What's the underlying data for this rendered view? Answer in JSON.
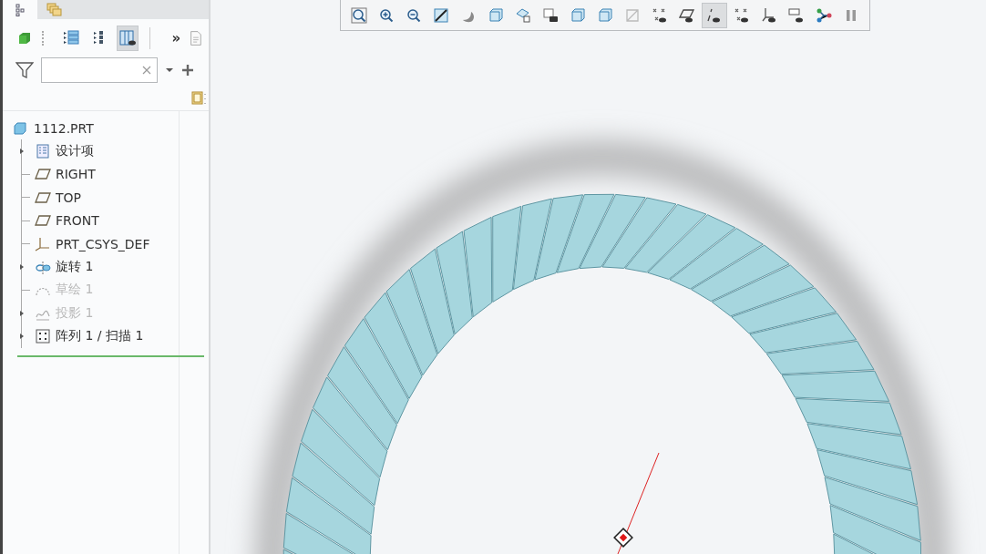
{
  "panel_tabs": [
    {
      "kind": "model-tree",
      "selected": true
    },
    {
      "kind": "layers",
      "selected": false
    }
  ],
  "panel_toolbar": [
    {
      "kind": "cube",
      "selected": false
    },
    {
      "kind": "tree-list",
      "selected": false
    },
    {
      "kind": "tree-dots",
      "selected": false
    },
    {
      "kind": "columns-eye",
      "selected": true
    }
  ],
  "more_label": "»",
  "tree": {
    "label": "1112.PRT",
    "kind": "part",
    "children": [
      {
        "label": "设计项",
        "kind": "design-items",
        "expanded": false,
        "disabled": false
      },
      {
        "label": "RIGHT",
        "kind": "plane",
        "disabled": false
      },
      {
        "label": "TOP",
        "kind": "plane",
        "disabled": false
      },
      {
        "label": "FRONT",
        "kind": "plane",
        "disabled": false
      },
      {
        "label": "PRT_CSYS_DEF",
        "kind": "csys",
        "disabled": false
      },
      {
        "label": "旋转 1",
        "kind": "revolve",
        "expanded": false,
        "disabled": false
      },
      {
        "label": "草绘 1",
        "kind": "sketch",
        "disabled": true
      },
      {
        "label": "投影 1",
        "kind": "projection",
        "expanded": false,
        "disabled": true
      },
      {
        "label": "阵列 1 / 扫描 1",
        "kind": "pattern",
        "expanded": false,
        "disabled": false
      }
    ]
  },
  "view_toolbar": [
    {
      "kind": "zoom-fit",
      "selected": false
    },
    {
      "kind": "zoom-in",
      "selected": false
    },
    {
      "kind": "zoom-out",
      "selected": false
    },
    {
      "kind": "repaint",
      "selected": false
    },
    {
      "kind": "display-style",
      "selected": false
    },
    {
      "kind": "saved-views",
      "selected": false
    },
    {
      "kind": "view-manager",
      "selected": false
    },
    {
      "kind": "perspective",
      "selected": false
    },
    {
      "kind": "section",
      "selected": false
    },
    {
      "kind": "appearance",
      "selected": false
    },
    {
      "kind": "annotation",
      "selected": false
    },
    {
      "kind": "datum-display",
      "selected": false
    },
    {
      "kind": "plane-display",
      "selected": false
    },
    {
      "kind": "axis-display",
      "selected": true
    },
    {
      "kind": "point-display",
      "selected": false
    },
    {
      "kind": "csys-display",
      "selected": false
    },
    {
      "kind": "tag-display",
      "selected": false
    },
    {
      "kind": "spin-center",
      "selected": false
    },
    {
      "kind": "pause",
      "selected": false
    }
  ]
}
